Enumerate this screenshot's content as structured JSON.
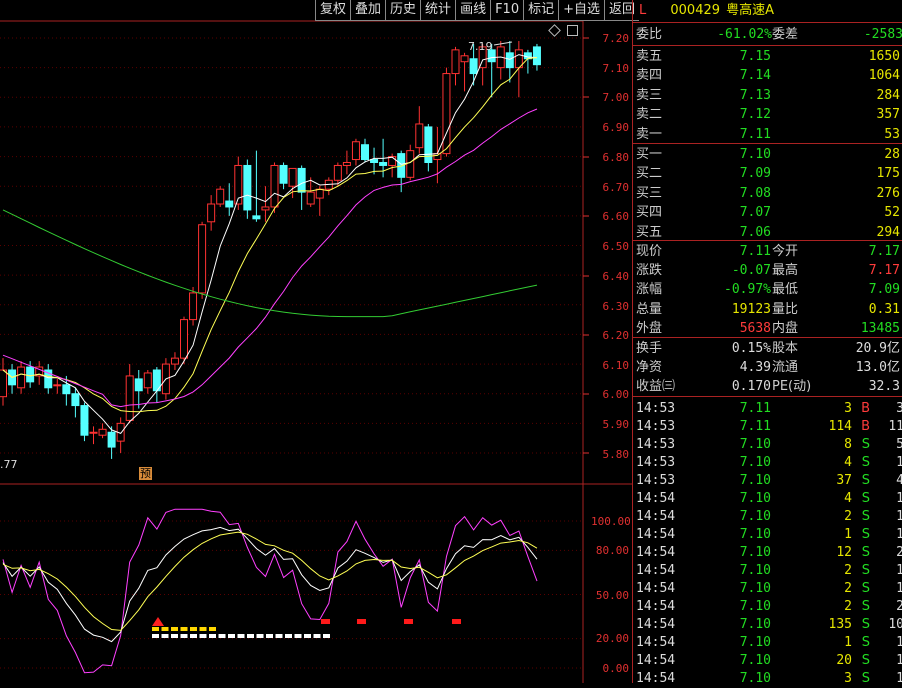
{
  "toolbar": {
    "buttons": [
      "复权",
      "叠加",
      "历史",
      "统计",
      "画线",
      "F10",
      "标记",
      "+自选",
      "返回"
    ]
  },
  "chart": {
    "price_axis": [
      "7.20",
      "7.10",
      "7.00",
      "6.90",
      "6.80",
      "6.70",
      "6.60",
      "6.50",
      "6.40",
      "6.30",
      "6.20",
      "6.10",
      "6.00",
      "5.90",
      "5.80"
    ],
    "indicator_axis": [
      "100.00",
      "80.00",
      "50.00",
      "20.00",
      "0.00"
    ],
    "high_label": "7.19",
    "low_label": ".77",
    "pre_marker": "预"
  },
  "colors": {
    "up": "#ff3232",
    "down": "#54ffff",
    "ma_white": "#ffffff",
    "ma_yellow": "#ffff55",
    "ma_magenta": "#ff40ff",
    "ma_green": "#33cc33",
    "axis_red": "#e03030",
    "panel_border": "#aa2222"
  },
  "stock": {
    "market": "L",
    "code": "000429",
    "name": "粤高速A"
  },
  "ratio": {
    "wb_label": "委比",
    "wb_value": "-61.02%",
    "wc_label": "委差",
    "wc_value": "-2583"
  },
  "asks": [
    {
      "label": "卖五",
      "price": "7.15",
      "vol": "1650"
    },
    {
      "label": "卖四",
      "price": "7.14",
      "vol": "1064"
    },
    {
      "label": "卖三",
      "price": "7.13",
      "vol": "284"
    },
    {
      "label": "卖二",
      "price": "7.12",
      "vol": "357"
    },
    {
      "label": "卖一",
      "price": "7.11",
      "vol": "53"
    }
  ],
  "bids": [
    {
      "label": "买一",
      "price": "7.10",
      "vol": "28"
    },
    {
      "label": "买二",
      "price": "7.09",
      "vol": "175"
    },
    {
      "label": "买三",
      "price": "7.08",
      "vol": "276"
    },
    {
      "label": "买四",
      "price": "7.07",
      "vol": "52"
    },
    {
      "label": "买五",
      "price": "7.06",
      "vol": "294"
    }
  ],
  "quote": [
    {
      "l1": "现价",
      "v1": "7.11",
      "l2": "今开",
      "v2": "7.17"
    },
    {
      "l1": "涨跌",
      "v1": "-0.07",
      "l2": "最高",
      "v2": "7.17"
    },
    {
      "l1": "涨幅",
      "v1": "-0.97%",
      "l2": "最低",
      "v2": "7.09"
    },
    {
      "l1": "总量",
      "v1": "19123",
      "l2": "量比",
      "v2": "0.31"
    },
    {
      "l1": "外盘",
      "v1": "5638",
      "l2": "内盘",
      "v2": "13485"
    }
  ],
  "fundamentals": [
    {
      "l1": "换手",
      "v1": "0.15%",
      "l2": "股本",
      "v2": "20.9亿"
    },
    {
      "l1": "净资",
      "v1": "4.39",
      "l2": "流通",
      "v2": "13.0亿"
    },
    {
      "l1": "收益㈢",
      "v1": "0.170",
      "l2": "PE(动)",
      "v2": "32.3"
    }
  ],
  "ticks": [
    {
      "time": "14:53",
      "price": "7.11",
      "vol": "3",
      "bs": "B",
      "n": "3"
    },
    {
      "time": "14:53",
      "price": "7.11",
      "vol": "114",
      "bs": "B",
      "n": "11"
    },
    {
      "time": "14:53",
      "price": "7.10",
      "vol": "8",
      "bs": "S",
      "n": "5"
    },
    {
      "time": "14:53",
      "price": "7.10",
      "vol": "4",
      "bs": "S",
      "n": "1"
    },
    {
      "time": "14:53",
      "price": "7.10",
      "vol": "37",
      "bs": "S",
      "n": "4"
    },
    {
      "time": "14:54",
      "price": "7.10",
      "vol": "4",
      "bs": "S",
      "n": "1"
    },
    {
      "time": "14:54",
      "price": "7.10",
      "vol": "2",
      "bs": "S",
      "n": "1"
    },
    {
      "time": "14:54",
      "price": "7.10",
      "vol": "1",
      "bs": "S",
      "n": "1"
    },
    {
      "time": "14:54",
      "price": "7.10",
      "vol": "12",
      "bs": "S",
      "n": "2"
    },
    {
      "time": "14:54",
      "price": "7.10",
      "vol": "2",
      "bs": "S",
      "n": "1"
    },
    {
      "time": "14:54",
      "price": "7.10",
      "vol": "2",
      "bs": "S",
      "n": "1"
    },
    {
      "time": "14:54",
      "price": "7.10",
      "vol": "2",
      "bs": "S",
      "n": "2"
    },
    {
      "time": "14:54",
      "price": "7.10",
      "vol": "135",
      "bs": "S",
      "n": "10"
    },
    {
      "time": "14:54",
      "price": "7.10",
      "vol": "1",
      "bs": "S",
      "n": "1"
    },
    {
      "time": "14:54",
      "price": "7.10",
      "vol": "20",
      "bs": "S",
      "n": "1"
    },
    {
      "time": "14:54",
      "price": "7.10",
      "vol": "3",
      "bs": "S",
      "n": "1"
    }
  ],
  "candles": [
    [
      5.99,
      6.08,
      6.12,
      5.96
    ],
    [
      6.08,
      6.03,
      6.1,
      6.0
    ],
    [
      6.02,
      6.09,
      6.11,
      6.0
    ],
    [
      6.09,
      6.04,
      6.11,
      6.02
    ],
    [
      6.06,
      6.09,
      6.11,
      6.03
    ],
    [
      6.08,
      6.02,
      6.1,
      6.0
    ],
    [
      6.03,
      6.03,
      6.05,
      6.0
    ],
    [
      6.03,
      6.0,
      6.06,
      5.96
    ],
    [
      6.0,
      5.96,
      6.02,
      5.92
    ],
    [
      5.96,
      5.86,
      5.97,
      5.84
    ],
    [
      5.87,
      5.87,
      5.89,
      5.83
    ],
    [
      5.86,
      5.88,
      5.9,
      5.85
    ],
    [
      5.87,
      5.82,
      5.89,
      5.78
    ],
    [
      5.84,
      5.9,
      5.92,
      5.8
    ],
    [
      5.91,
      6.06,
      6.1,
      5.9
    ],
    [
      6.05,
      6.01,
      6.08,
      5.95
    ],
    [
      6.02,
      6.07,
      6.08,
      6.0
    ],
    [
      6.08,
      6.01,
      6.09,
      5.97
    ],
    [
      6.0,
      6.1,
      6.12,
      5.98
    ],
    [
      6.1,
      6.12,
      6.14,
      6.08
    ],
    [
      6.12,
      6.25,
      6.26,
      6.1
    ],
    [
      6.25,
      6.34,
      6.36,
      6.23
    ],
    [
      6.34,
      6.57,
      6.58,
      6.32
    ],
    [
      6.58,
      6.64,
      6.67,
      6.55
    ],
    [
      6.64,
      6.69,
      6.7,
      6.63
    ],
    [
      6.65,
      6.63,
      6.71,
      6.6
    ],
    [
      6.64,
      6.77,
      6.8,
      6.62
    ],
    [
      6.77,
      6.62,
      6.79,
      6.59
    ],
    [
      6.6,
      6.59,
      6.82,
      6.58
    ],
    [
      6.62,
      6.63,
      6.7,
      6.58
    ],
    [
      6.63,
      6.77,
      6.78,
      6.61
    ],
    [
      6.77,
      6.71,
      6.78,
      6.69
    ],
    [
      6.7,
      6.76,
      6.76,
      6.66
    ],
    [
      6.76,
      6.68,
      6.77,
      6.62
    ],
    [
      6.64,
      6.68,
      6.73,
      6.63
    ],
    [
      6.66,
      6.69,
      6.7,
      6.6
    ],
    [
      6.69,
      6.72,
      6.73,
      6.67
    ],
    [
      6.72,
      6.77,
      6.78,
      6.7
    ],
    [
      6.77,
      6.78,
      6.82,
      6.74
    ],
    [
      6.79,
      6.85,
      6.86,
      6.77
    ],
    [
      6.84,
      6.79,
      6.86,
      6.78
    ],
    [
      6.79,
      6.78,
      6.83,
      6.74
    ],
    [
      6.78,
      6.77,
      6.86,
      6.73
    ],
    [
      6.77,
      6.8,
      6.81,
      6.73
    ],
    [
      6.81,
      6.73,
      6.82,
      6.68
    ],
    [
      6.73,
      6.82,
      6.84,
      6.72
    ],
    [
      6.83,
      6.91,
      6.97,
      6.81
    ],
    [
      6.9,
      6.78,
      6.91,
      6.75
    ],
    [
      6.79,
      6.81,
      6.9,
      6.71
    ],
    [
      6.81,
      7.08,
      7.1,
      6.8
    ],
    [
      7.08,
      7.16,
      7.17,
      7.04
    ],
    [
      7.12,
      7.14,
      7.15,
      7.02
    ],
    [
      7.13,
      7.08,
      7.18,
      7.04
    ],
    [
      7.1,
      7.17,
      7.18,
      7.04
    ],
    [
      7.16,
      7.12,
      7.18,
      7.0
    ],
    [
      7.1,
      7.17,
      7.19,
      7.06
    ],
    [
      7.15,
      7.1,
      7.19,
      7.05
    ],
    [
      7.1,
      7.16,
      7.19,
      7.0
    ],
    [
      7.15,
      7.13,
      7.16,
      7.08
    ],
    [
      7.17,
      7.11,
      7.18,
      7.09
    ]
  ]
}
